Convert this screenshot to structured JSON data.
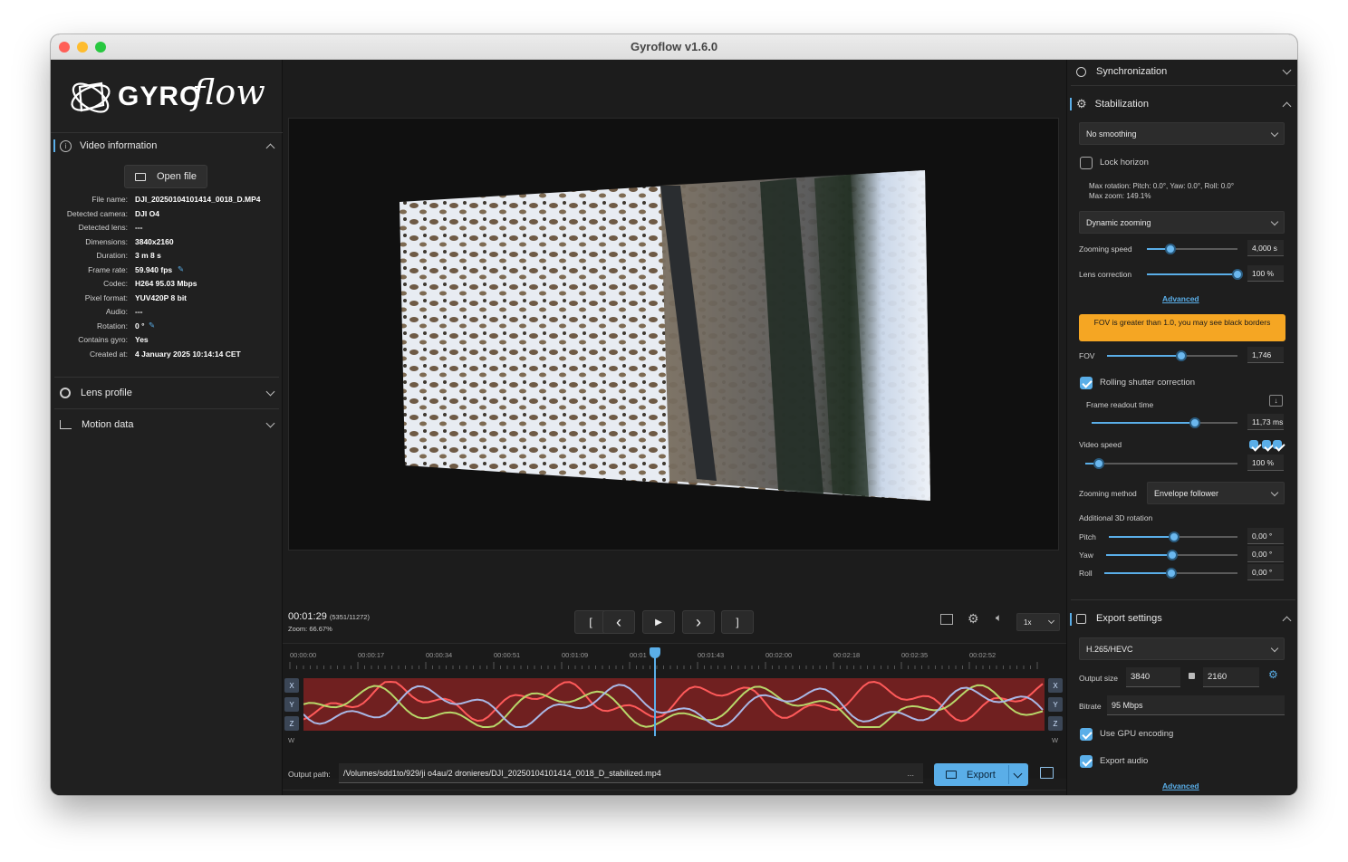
{
  "window": {
    "title": "Gyroflow v1.6.0"
  },
  "left": {
    "logo_text": "GYRO",
    "logo_script": "flow",
    "video_info": {
      "title": "Video information",
      "open_file": "Open file",
      "rows": [
        {
          "k": "File name:",
          "v": "DJI_20250104101414_0018_D.MP4"
        },
        {
          "k": "Detected camera:",
          "v": "DJI O4"
        },
        {
          "k": "Detected lens:",
          "v": "---"
        },
        {
          "k": "Dimensions:",
          "v": "3840x2160"
        },
        {
          "k": "Duration:",
          "v": "3 m 8 s"
        },
        {
          "k": "Frame rate:",
          "v": "59.940 fps"
        },
        {
          "k": "Codec:",
          "v": "H264 95.03 Mbps"
        },
        {
          "k": "Pixel format:",
          "v": "YUV420P 8 bit"
        },
        {
          "k": "Audio:",
          "v": "---"
        },
        {
          "k": "Rotation:",
          "v": "0 °"
        },
        {
          "k": "Contains gyro:",
          "v": "Yes"
        },
        {
          "k": "Created at:",
          "v": "4 January 2025 10:14:14 CET"
        }
      ]
    },
    "lens_profile": "Lens profile",
    "motion_data": "Motion data"
  },
  "player": {
    "timecode": "00:01:29",
    "frame": "(5351/11272)",
    "zoom": "Zoom: 66.67%",
    "controls": [
      "[",
      "‹",
      "▶",
      "›",
      "]"
    ],
    "speed": "1x"
  },
  "timeline": {
    "ticks": [
      "00:00:00",
      "00:00:17",
      "00:00:34",
      "00:00:51",
      "00:01:09",
      "00:01",
      "00:01:43",
      "00:02:00",
      "00:02:18",
      "00:02:35",
      "00:02:52"
    ],
    "axes": [
      "X",
      "Y",
      "Z"
    ],
    "w_label": "W",
    "colors": {
      "x": "#ff5a5a",
      "y": "#b8d86a",
      "z": "#a9b8e6",
      "bg": "#7a2222",
      "playhead": "#5aaee8"
    }
  },
  "bottom": {
    "output_label": "Output path:",
    "output_path": "/Volumes/sdd1to/929/ji o4au/2 dronieres/DJI_20250104101414_0018_D_stabilized.mp4",
    "dots": "...",
    "export": "Export"
  },
  "right": {
    "sync": "Synchronization",
    "stabilization": "Stabilization",
    "smoothing": "No smoothing",
    "lock_horizon": "Lock horizon",
    "max_rotation": "Max rotation: Pitch: 0.0°, Yaw: 0.0°, Roll: 0.0°",
    "max_zoom": "Max zoom: 149.1%",
    "dyn_zoom": "Dynamic zooming",
    "zoom_speed_label": "Zooming speed",
    "zoom_speed_val": "4,000 s",
    "lens_corr_label": "Lens correction",
    "lens_corr_val": "100 %",
    "advanced": "Advanced",
    "warning": "FOV is greater than 1.0, you may see black borders",
    "fov_label": "FOV",
    "fov_val": "1,746",
    "rolling": "Rolling shutter correction",
    "readout_label": "Frame readout time",
    "readout_val": "11,73 ms",
    "video_speed_label": "Video speed",
    "video_speed_val": "100 %",
    "zoom_method_label": "Zooming method",
    "zoom_method_val": "Envelope follower",
    "add_rot": "Additional 3D rotation",
    "pitch_label": "Pitch",
    "pitch_val": "0,00 °",
    "yaw_label": "Yaw",
    "yaw_val": "0,00 °",
    "roll_label": "Roll",
    "roll_val": "0,00 °",
    "export_settings": "Export settings",
    "codec": "H.265/HEVC",
    "output_size_label": "Output size",
    "width": "3840",
    "height": "2160",
    "bitrate_label": "Bitrate",
    "bitrate": "95 Mbps",
    "gpu": "Use GPU encoding",
    "export_audio": "Export audio",
    "advanced2": "Advanced",
    "warning_color": "#f5a623",
    "accent": "#5aaee8"
  }
}
